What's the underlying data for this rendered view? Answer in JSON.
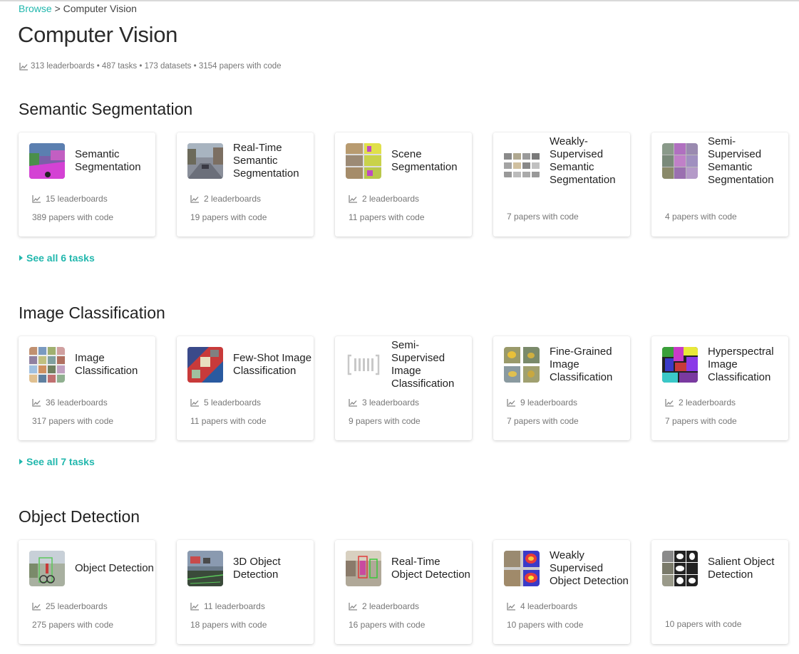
{
  "breadcrumb": {
    "link": "Browse",
    "separator": ">",
    "current": "Computer Vision"
  },
  "page_title": "Computer Vision",
  "stats": "313 leaderboards • 487 tasks • 173 datasets • 3154 papers with code",
  "sections": [
    {
      "title": "Semantic Segmentation",
      "see_all": "See all 6 tasks",
      "cards": [
        {
          "title": "Semantic Segmentation",
          "leaderboards": "15 leaderboards",
          "papers": "389 papers with code",
          "thumb": "street-segmentation-icon"
        },
        {
          "title": "Real-Time Semantic Segmentation",
          "leaderboards": "2 leaderboards",
          "papers": "19 papers with code",
          "thumb": "street-scene-icon"
        },
        {
          "title": "Scene Segmentation",
          "leaderboards": "2 leaderboards",
          "papers": "11 papers with code",
          "thumb": "scene-grid-icon"
        },
        {
          "title": "Weakly-Supervised Semantic Segmentation",
          "leaderboards": "",
          "papers": "7 papers with code",
          "thumb": "weak-seg-grid-icon"
        },
        {
          "title": "Semi-Supervised Semantic Segmentation",
          "leaderboards": "",
          "papers": "4 papers with code",
          "thumb": "semi-seg-grid-icon"
        }
      ]
    },
    {
      "title": "Image Classification",
      "see_all": "See all 7 tasks",
      "cards": [
        {
          "title": "Image Classification",
          "leaderboards": "36 leaderboards",
          "papers": "317 papers with code",
          "thumb": "image-grid-icon"
        },
        {
          "title": "Few-Shot Image Classification",
          "leaderboards": "5 leaderboards",
          "papers": "11 papers with code",
          "thumb": "few-shot-icon"
        },
        {
          "title": "Semi-Supervised Image Classification",
          "leaderboards": "3 leaderboards",
          "papers": "9 papers with code",
          "thumb": "barcode-placeholder-icon"
        },
        {
          "title": "Fine-Grained Image Classification",
          "leaderboards": "9 leaderboards",
          "papers": "7 papers with code",
          "thumb": "birds-grid-icon"
        },
        {
          "title": "Hyperspectral Image Classification",
          "leaderboards": "2 leaderboards",
          "papers": "7 papers with code",
          "thumb": "hyperspectral-map-icon"
        }
      ]
    },
    {
      "title": "Object Detection",
      "see_all": "",
      "cards": [
        {
          "title": "Object Detection",
          "leaderboards": "25 leaderboards",
          "papers": "275 papers with code",
          "thumb": "cyclist-detection-icon"
        },
        {
          "title": "3D Object Detection",
          "leaderboards": "11 leaderboards",
          "papers": "18 papers with code",
          "thumb": "lidar-scene-icon"
        },
        {
          "title": "Real-Time Object Detection",
          "leaderboards": "2 leaderboards",
          "papers": "16 papers with code",
          "thumb": "street-boxes-icon"
        },
        {
          "title": "Weakly Supervised Object Detection",
          "leaderboards": "4 leaderboards",
          "papers": "10 papers with code",
          "thumb": "heatmap-icon"
        },
        {
          "title": "Salient Object Detection",
          "leaderboards": "",
          "papers": "10 papers with code",
          "thumb": "saliency-grid-icon"
        }
      ]
    }
  ],
  "colors": {
    "accent": "#21b7ad",
    "muted": "#777777",
    "text": "#222222"
  }
}
